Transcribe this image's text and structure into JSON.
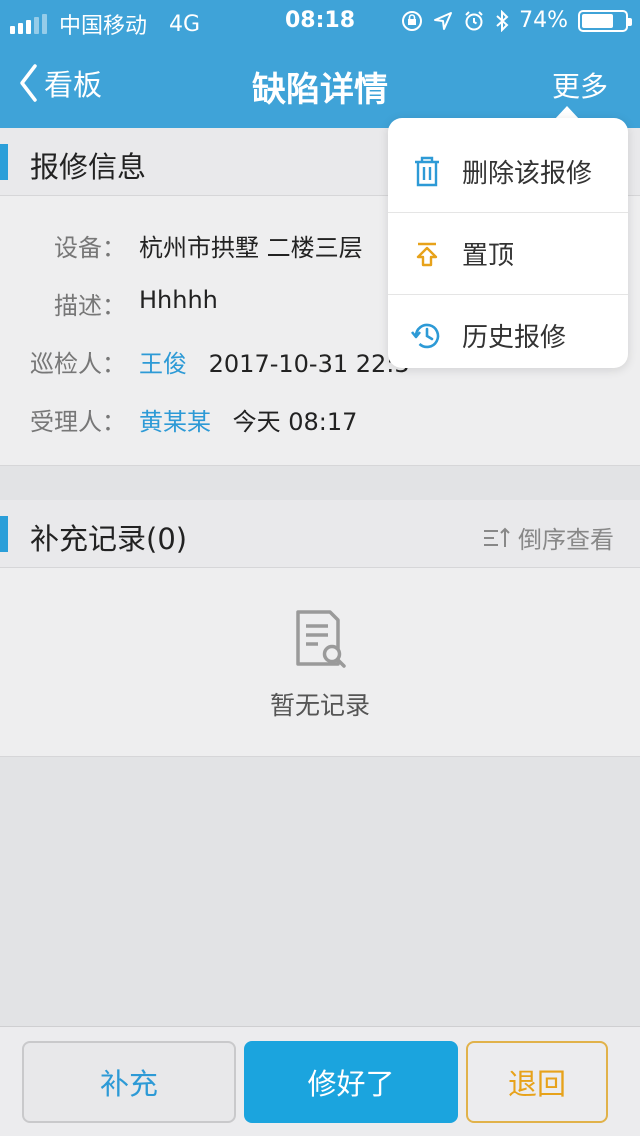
{
  "status_bar": {
    "carrier": "中国移动",
    "network": "4G",
    "time": "08:18",
    "battery": "74%",
    "battery_level": 0.74
  },
  "nav": {
    "back_label": "看板",
    "title": "缺陷详情",
    "more_label": "更多"
  },
  "repair_info": {
    "section_title": "报修信息",
    "rows": [
      {
        "label": "设备：",
        "value": "杭州市拱墅 二楼三层"
      },
      {
        "label": "描述：",
        "value": "Hhhhh"
      },
      {
        "label": "巡检人：",
        "person": "王俊",
        "value": "2017-10-31 22:3"
      },
      {
        "label": "受理人：",
        "person": "黄某某",
        "value": "今天 08:17"
      }
    ]
  },
  "records": {
    "section_title": "补充记录(0)",
    "sort_label": "倒序查看",
    "empty_text": "暂无记录"
  },
  "dropdown_menu": {
    "items": [
      {
        "label": "删除该报修",
        "icon": "trash-icon",
        "color": "#2d9ad6"
      },
      {
        "label": "置顶",
        "icon": "pin-top-icon",
        "color": "#e7a21a"
      },
      {
        "label": "历史报修",
        "icon": "history-icon",
        "color": "#2d9ad6"
      }
    ]
  },
  "actions": {
    "supplement": "补充",
    "fixed": "修好了",
    "return": "退回"
  },
  "colors": {
    "header": "#3fa3d8",
    "accent": "#2d9ad6",
    "primary_button": "#1ba4de",
    "warning": "#e7a21a"
  }
}
